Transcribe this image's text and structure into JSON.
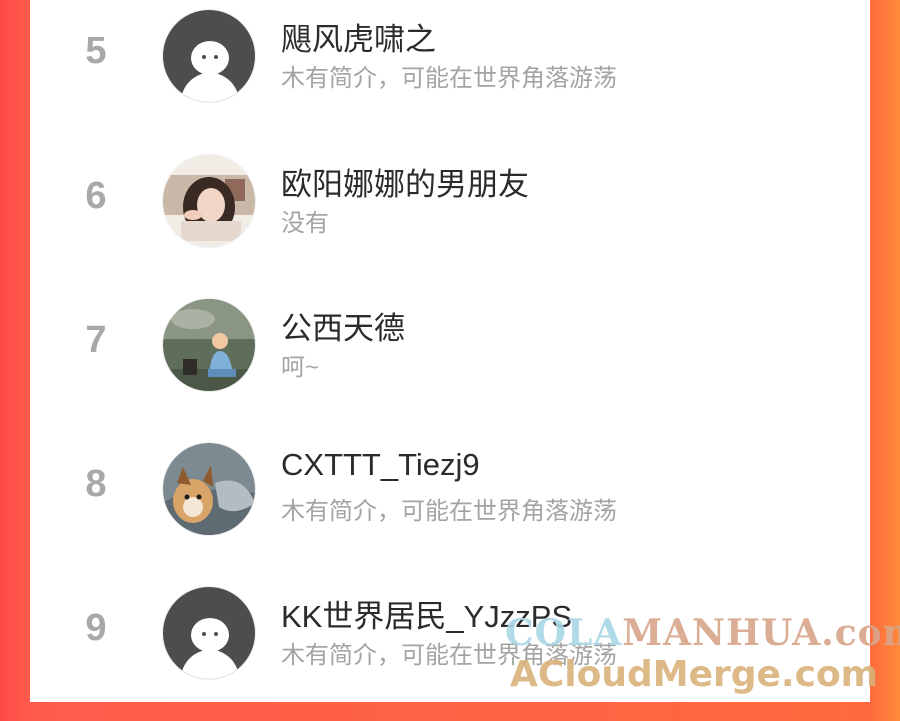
{
  "ranking": [
    {
      "rank": "5",
      "name": "飓风虎啸之",
      "bio": "木有简介，可能在世界角落游荡",
      "avatar": "default-avatar"
    },
    {
      "rank": "6",
      "name": "欧阳娜娜的男朋友",
      "bio": "没有",
      "avatar": "photo-avatar-girl"
    },
    {
      "rank": "7",
      "name": "公西天德",
      "bio": "呵~",
      "avatar": "photo-avatar-child"
    },
    {
      "rank": "8",
      "name": "CXTTT_Tiezj9",
      "bio": "木有简介，可能在世界角落游荡",
      "avatar": "photo-avatar-dog"
    },
    {
      "rank": "9",
      "name": "KK世界居民_YJzzPS",
      "bio": "木有简介，可能在世界角落游荡",
      "avatar": "default-avatar"
    }
  ],
  "watermark": {
    "line1_prefix": "COLA",
    "line1_suffix": "MANHUA.com",
    "line2": "ACloudMerge.com"
  },
  "colors": {
    "background_left": "#ff4a47",
    "background_right": "#ff8a3a",
    "rank_gray": "#a8a8a8",
    "name_text": "#2b2b2b",
    "bio_text": "#a4a4a4"
  }
}
